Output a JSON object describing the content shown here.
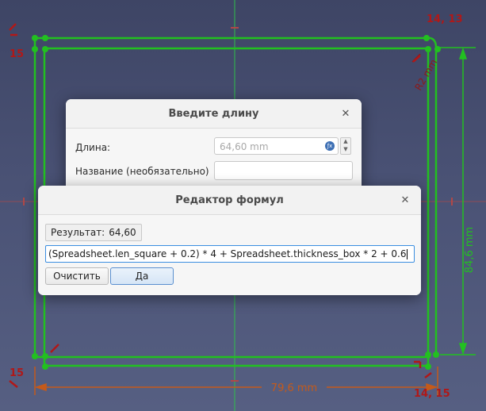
{
  "sketch": {
    "constraint_labels": {
      "top_right": "14, 13",
      "top_left": "15",
      "bottom_left": "15",
      "bottom_right": "14, 15"
    },
    "dimensions": {
      "bottom": "79,6 mm",
      "right": "84,6 mm",
      "radius": "R2 mm"
    },
    "colors": {
      "sketch_line": "#22c020",
      "axis_line": "#2fbf4a",
      "dimension": "#8b1a1a",
      "dimension_orange": "#c55a1a",
      "background_top": "#3e4565",
      "background_bottom": "#565f82"
    }
  },
  "length_dialog": {
    "title": "Введите длину",
    "close_icon": "close-icon",
    "length_label": "Длина:",
    "length_value": "64,60 mm",
    "name_label": "Название (необязательно)",
    "name_value": ""
  },
  "formula_dialog": {
    "title": "Редактор формул",
    "close_icon": "close-icon",
    "result_label": "Результат:",
    "result_value": "64,60",
    "formula": "(Spreadsheet.len_square + 0.2) * 4 + Spreadsheet.thickness_box * 2 + 0.6",
    "clear_button": "Очистить",
    "ok_button": "Да"
  }
}
